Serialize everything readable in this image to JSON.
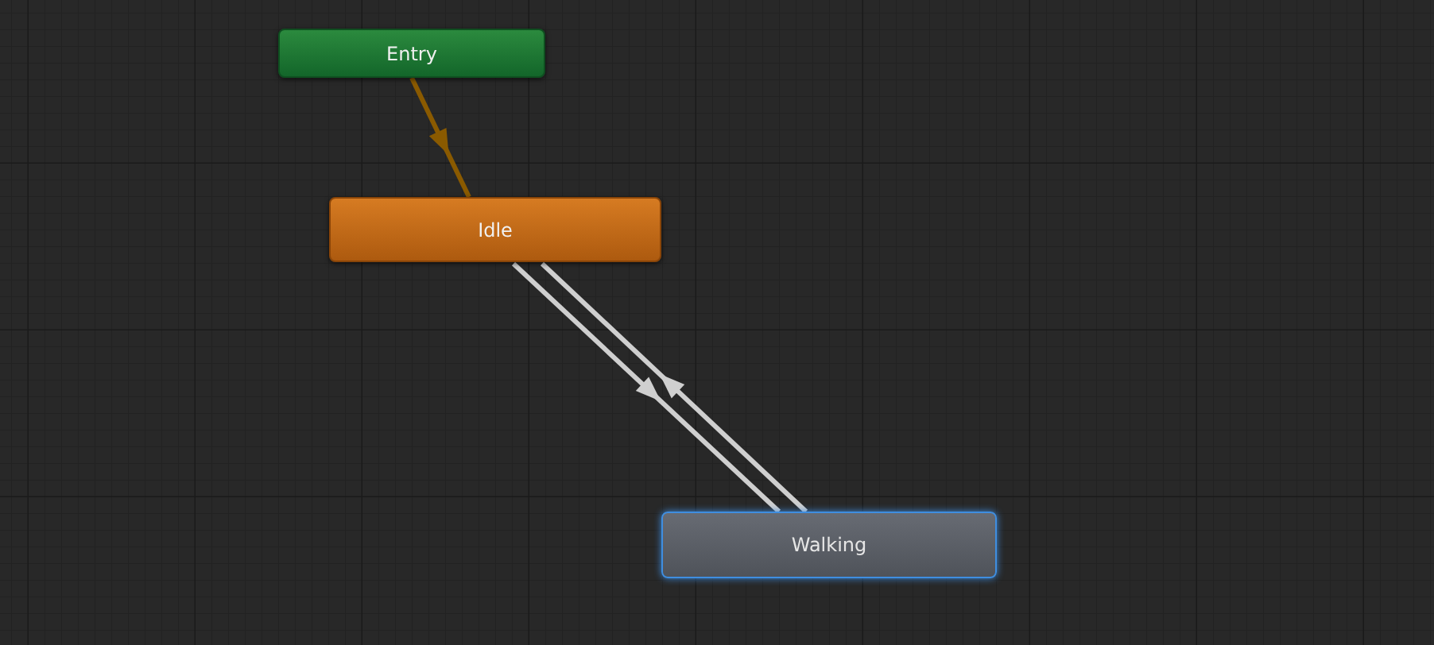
{
  "nodes": [
    {
      "label": "Entry",
      "kind": "entry",
      "selected": false
    },
    {
      "label": "Idle",
      "kind": "default",
      "selected": false
    },
    {
      "label": "Walking",
      "kind": "state",
      "selected": true
    }
  ]
}
